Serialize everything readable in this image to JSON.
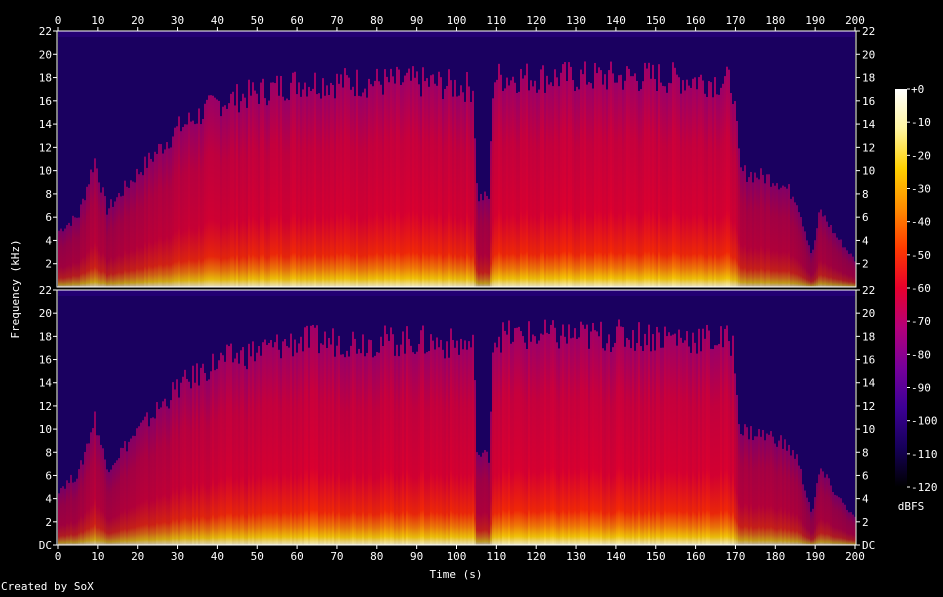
{
  "chart_data": {
    "type": "heatmap",
    "title": "",
    "xlabel": "Time (s)",
    "ylabel": "Frequency (kHz)",
    "colorbar_label": "dBFS",
    "footer": "Created by SoX",
    "x_ticks": [
      "0",
      "10",
      "20",
      "30",
      "40",
      "50",
      "60",
      "70",
      "80",
      "90",
      "100",
      "110",
      "120",
      "130",
      "140",
      "150",
      "160",
      "170",
      "180",
      "190",
      "200"
    ],
    "xlim": [
      0,
      200
    ],
    "panels": [
      {
        "name": "upper",
        "y_ticks_left": [
          "2",
          "4",
          "6",
          "8",
          "10",
          "12",
          "14",
          "16",
          "18",
          "20",
          "22"
        ],
        "y_ticks_right": [
          "2",
          "4",
          "6",
          "8",
          "10",
          "12",
          "14",
          "16",
          "18",
          "20",
          "22"
        ]
      },
      {
        "name": "lower",
        "y_ticks_left": [
          "DC",
          "2",
          "4",
          "6",
          "8",
          "10",
          "12",
          "14",
          "16",
          "18",
          "20",
          "22"
        ],
        "y_ticks_right": [
          "DC",
          "2",
          "4",
          "6",
          "8",
          "10",
          "12",
          "14",
          "16",
          "18",
          "20",
          "22"
        ]
      }
    ],
    "ylim": [
      0,
      22
    ],
    "colorbar": {
      "ticks": [
        "+0",
        "-10",
        "-20",
        "-30",
        "-40",
        "-50",
        "-60",
        "-70",
        "-80",
        "-90",
        "-100",
        "-110",
        "-120"
      ],
      "range": [
        -120,
        0
      ]
    },
    "energy_profile": {
      "time_s": [
        0,
        5,
        9,
        12,
        20,
        30,
        40,
        60,
        90,
        104,
        105,
        108,
        109,
        120,
        150,
        169,
        171,
        180,
        185,
        189,
        191,
        195,
        200
      ],
      "level": [
        0.22,
        0.28,
        0.5,
        0.3,
        0.45,
        0.62,
        0.72,
        0.8,
        0.8,
        0.78,
        0.35,
        0.35,
        0.82,
        0.82,
        0.82,
        0.8,
        0.45,
        0.42,
        0.35,
        0.12,
        0.3,
        0.2,
        0.1
      ]
    },
    "colors": {
      "palette": [
        "#000000",
        "#16005a",
        "#3d0096",
        "#77009a",
        "#b4007a",
        "#e6002c",
        "#ff3a00",
        "#ff8c00",
        "#ffd000",
        "#fff5a0",
        "#ffffff"
      ]
    }
  }
}
